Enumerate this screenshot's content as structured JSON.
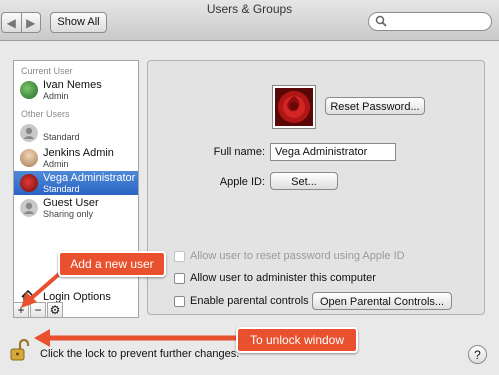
{
  "window": {
    "title": "Users & Groups"
  },
  "toolbar": {
    "back_glyph": "◀",
    "forward_glyph": "▶",
    "show_all_label": "Show All",
    "search_placeholder": ""
  },
  "sidebar": {
    "current_users_header": "Current User",
    "other_users_header": "Other Users",
    "users": [
      {
        "name": "Ivan Nemes",
        "role": "Admin"
      },
      {
        "name": "",
        "role": "Standard"
      },
      {
        "name": "Jenkins Admin",
        "role": "Admin"
      },
      {
        "name": "Vega Administrator",
        "role": "Standard"
      },
      {
        "name": "Guest User",
        "role": "Sharing only"
      }
    ],
    "login_options_label": "Login Options",
    "add_glyph": "+",
    "remove_glyph": "−",
    "gear_glyph": "⚙"
  },
  "detail": {
    "reset_password_label": "Reset Password...",
    "full_name_label": "Full name:",
    "full_name_value": "Vega Administrator",
    "apple_id_label": "Apple ID:",
    "apple_id_set_label": "Set...",
    "allow_reset_label": "Allow user to reset password using Apple ID",
    "allow_admin_label": "Allow user to administer this computer",
    "parental_controls_label": "Enable parental controls",
    "open_parental_label": "Open Parental Controls..."
  },
  "footer": {
    "lock_text": "Click the lock to prevent further changes.",
    "help_glyph": "?"
  },
  "annotations": {
    "add_user": "Add a new user",
    "unlock": "To unlock window"
  },
  "colors": {
    "selection": "#2a64c3",
    "callout": "#e8502e"
  }
}
